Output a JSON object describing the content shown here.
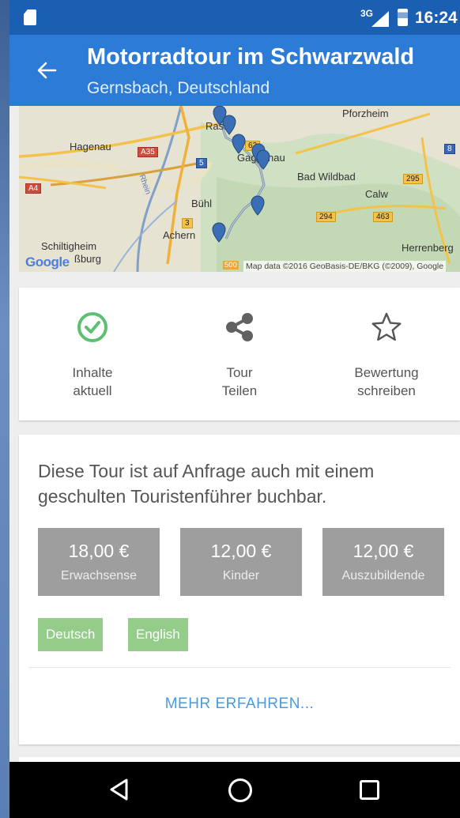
{
  "status_bar": {
    "network": "3G",
    "time": "16:24",
    "icons": [
      "sd-card-icon",
      "signal-icon",
      "battery-icon"
    ]
  },
  "app_bar": {
    "back_icon": "arrow-left-icon",
    "title": "Motorradtour im Schwarzwald",
    "subtitle": "Gernsbach, Deutschland",
    "color": "#2c7bd6"
  },
  "map": {
    "places": {
      "pforzheim": "Pforzheim",
      "hagenau": "Hagenau",
      "rastatt": "Rast",
      "gaggenau": "Gaggenau",
      "bad_wildbad": "Bad Wildbad",
      "calw": "Calw",
      "buehl": "Bühl",
      "achern": "Achern",
      "schiltigheim": "Schiltigheim",
      "strasbourg": "ßburg",
      "herrenberg": "Herrenberg",
      "rhein": "Rhein"
    },
    "roads": {
      "a35": "A35",
      "a4": "A4",
      "b5": "5",
      "b3": "3",
      "b62": "62",
      "b295": "295",
      "b294": "294",
      "b463": "463",
      "b8": "8"
    },
    "logo": "Google",
    "scale": "500",
    "attribution": "Map data ©2016 GeoBasis-DE/BKG (©2009), Google",
    "marker_color": "#3a6fb5"
  },
  "actions": [
    {
      "icon": "check-circle-icon",
      "line1": "Inhalte",
      "line2": "aktuell",
      "icon_color": "#5cbf72"
    },
    {
      "icon": "share-icon",
      "line1": "Tour",
      "line2": "Teilen"
    },
    {
      "icon": "star-outline-icon",
      "line1": "Bewertung",
      "line2": "schreiben"
    }
  ],
  "info": {
    "text": "Diese Tour ist auf Anfrage auch mit einem geschulten Touristenführer buchbar.",
    "prices": [
      {
        "amount": "18,00 €",
        "category": "Erwachsense"
      },
      {
        "amount": "12,00 €",
        "category": "Kinder"
      },
      {
        "amount": "12,00 €",
        "category": "Auszubildende"
      }
    ],
    "languages": [
      "Deutsch",
      "English"
    ],
    "more_link": "MEHR ERFAHREN...",
    "price_color": "#9e9e9e",
    "language_color": "#94cd8a",
    "link_color": "#4a9ae0"
  },
  "nav_bar": {
    "icons": [
      "nav-back-icon",
      "nav-home-icon",
      "nav-recent-apps-icon"
    ]
  }
}
